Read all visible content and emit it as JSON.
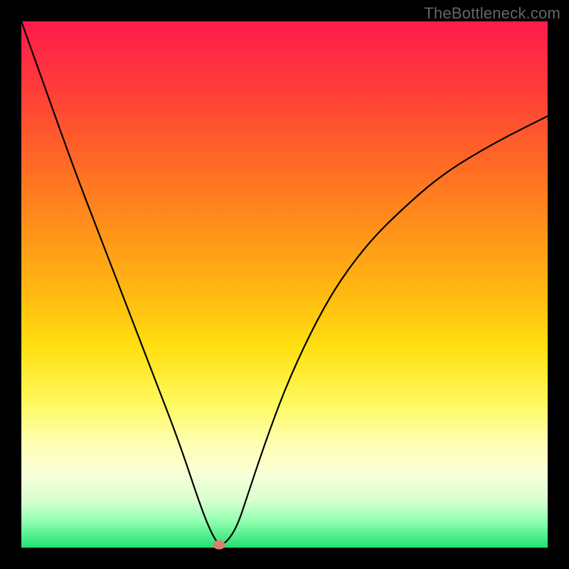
{
  "watermark": "TheBottleneck.com",
  "chart_data": {
    "type": "line",
    "title": "",
    "xlabel": "",
    "ylabel": "",
    "xlim": [
      0,
      100
    ],
    "ylim": [
      0,
      100
    ],
    "series": [
      {
        "name": "curve",
        "x": [
          0,
          5,
          10,
          15,
          20,
          25,
          30,
          34,
          36,
          37.5,
          39,
          41,
          43,
          46,
          50,
          55,
          60,
          66,
          72,
          80,
          90,
          100
        ],
        "values": [
          100,
          86,
          72,
          59,
          46,
          33,
          20,
          8,
          3,
          0.5,
          1,
          4,
          10,
          19,
          30,
          41,
          50,
          58,
          64,
          71,
          77,
          82
        ]
      }
    ],
    "marker": {
      "x": 37.5,
      "y": 0.5
    },
    "background_gradient": {
      "top": "#ff1a4d",
      "bottom": "#20e070"
    }
  }
}
